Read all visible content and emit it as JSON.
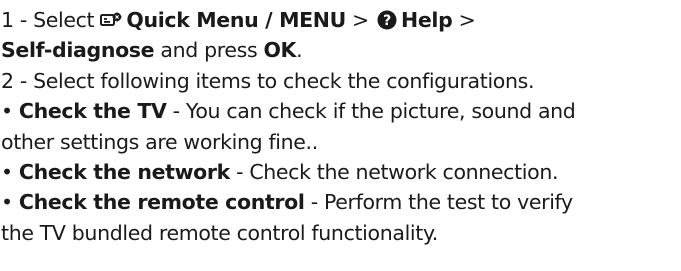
{
  "step1": {
    "number": "1 - Select",
    "quick_menu": "Quick Menu / MENU",
    "separator1": ">",
    "help": "Help",
    "separator2": ">",
    "self_diagnose": "Self-diagnose",
    "middle": "and press",
    "ok": "OK",
    "end": "."
  },
  "step2": {
    "text": "2 - Select following items to check the configurations."
  },
  "items": [
    {
      "bullet": "•",
      "label": "Check the TV",
      "desc_line1": " - You can check if the picture, sound and",
      "desc_line2": "other settings are working fine.."
    },
    {
      "bullet": "•",
      "label": "Check the network",
      "desc_line1": " - Check the network connection.",
      "desc_line2": ""
    },
    {
      "bullet": "•",
      "label": "Check the remote control",
      "desc_line1": " - Perform the test to verify",
      "desc_line2": "the TV bundled  remote control functionality."
    }
  ],
  "icons": {
    "quick_menu": "quick-menu-icon",
    "help": "help-icon"
  },
  "colors": {
    "text": "#1a1a1a",
    "icon": "#1a1a1a"
  }
}
